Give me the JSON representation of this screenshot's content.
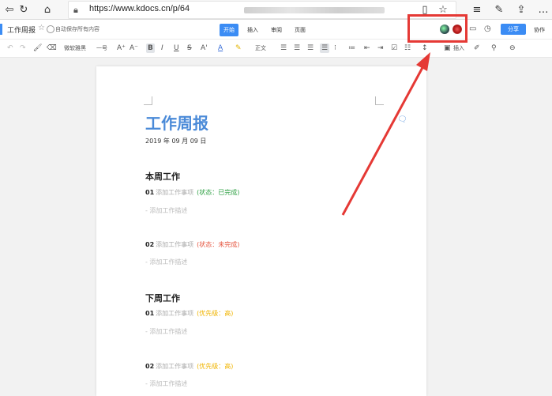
{
  "browser": {
    "url": "https://www.kdocs.cn/p/64"
  },
  "appbar": {
    "doc_title": "工作周报",
    "autosave_text": "自动保存所有内容",
    "tabs": [
      "开始",
      "插入",
      "审阅",
      "页面"
    ],
    "share_label": "分享",
    "collab_label": "协作"
  },
  "toolbar": {
    "font_name": "微软雅黑",
    "font_size": "一号",
    "text_style": "正文",
    "insert_label": "插入"
  },
  "document": {
    "title": "工作周报",
    "date": "2019 年 09 月 09 日",
    "sections": [
      {
        "heading": "本周工作",
        "items": [
          {
            "num": "01",
            "text": "添加工作事项",
            "status": "(状态：已完成)",
            "status_color": "#2ea043",
            "desc": "- 添加工作描述"
          },
          {
            "num": "02",
            "text": "添加工作事项",
            "status": "(状态：未完成)",
            "status_color": "#e5533d",
            "desc": "- 添加工作描述"
          }
        ]
      },
      {
        "heading": "下周工作",
        "items": [
          {
            "num": "01",
            "text": "添加工作事项",
            "status": "(优先级：高)",
            "status_color": "#f0b400",
            "desc": "- 添加工作描述"
          },
          {
            "num": "02",
            "text": "添加工作事项",
            "status": "(优先级：高)",
            "status_color": "#f0b400",
            "desc": "- 添加工作描述"
          }
        ]
      }
    ]
  },
  "colors": {
    "accent": "#3b8cf4",
    "highlight_box": "#e53935"
  }
}
